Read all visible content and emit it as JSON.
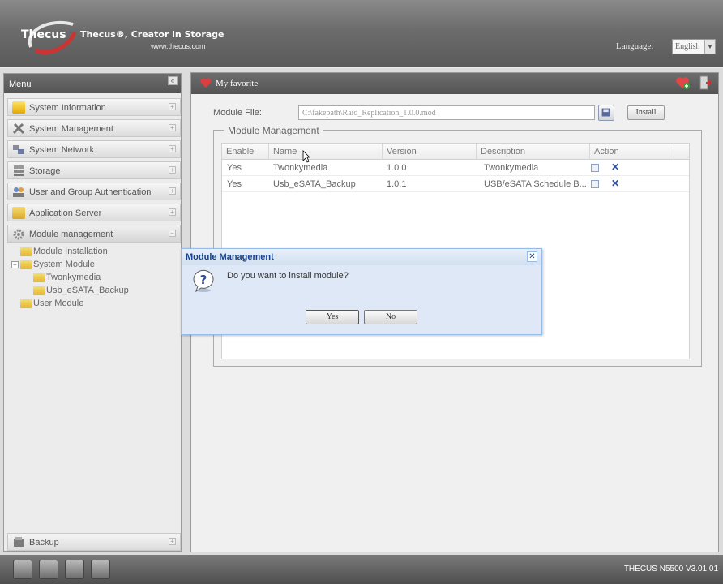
{
  "header": {
    "logo_text": "Thecus",
    "tagline": "Thecus®, Creator in Storage",
    "website": "www.thecus.com",
    "language_label": "Language:",
    "language_value": "English"
  },
  "sidebar": {
    "title": "Menu",
    "items": [
      {
        "label": "System Information",
        "icon": "info-icon"
      },
      {
        "label": "System Management",
        "icon": "tools-icon"
      },
      {
        "label": "System Network",
        "icon": "network-icon"
      },
      {
        "label": "Storage",
        "icon": "storage-icon"
      },
      {
        "label": "User and Group Authentication",
        "icon": "users-icon"
      },
      {
        "label": "Application Server",
        "icon": "folder-icon"
      },
      {
        "label": "Module management",
        "icon": "gear-icon"
      }
    ],
    "tree": {
      "install": "Module Installation",
      "system_module": "System Module",
      "twonky": "Twonkymedia",
      "usb": "Usb_eSATA_Backup",
      "user_module": "User Module"
    },
    "backup": "Backup"
  },
  "main": {
    "title": "My favorite",
    "module_file_label": "Module File:",
    "module_file_value": "C:\\fakepath\\Raid_Replication_1.0.0.mod",
    "install_label": "Install",
    "section_title": "Module Management",
    "columns": [
      "Enable",
      "Name",
      "Version",
      "Description",
      "Action"
    ],
    "rows": [
      {
        "enable": "Yes",
        "name": "Twonkymedia",
        "version": "1.0.0",
        "description": "Twonkymedia"
      },
      {
        "enable": "Yes",
        "name": "Usb_eSATA_Backup",
        "version": "1.0.1",
        "description": "USB/eSATA Schedule B..."
      }
    ]
  },
  "dialog": {
    "title": "Module Management",
    "message": "Do you want to install module?",
    "yes": "Yes",
    "no": "No"
  },
  "footer": {
    "model": "THECUS N5500 V3.01.01"
  },
  "colors": {
    "header": "#6c6c6c",
    "dialog_bg": "#dfe8f6",
    "dialog_title": "#15428b"
  }
}
